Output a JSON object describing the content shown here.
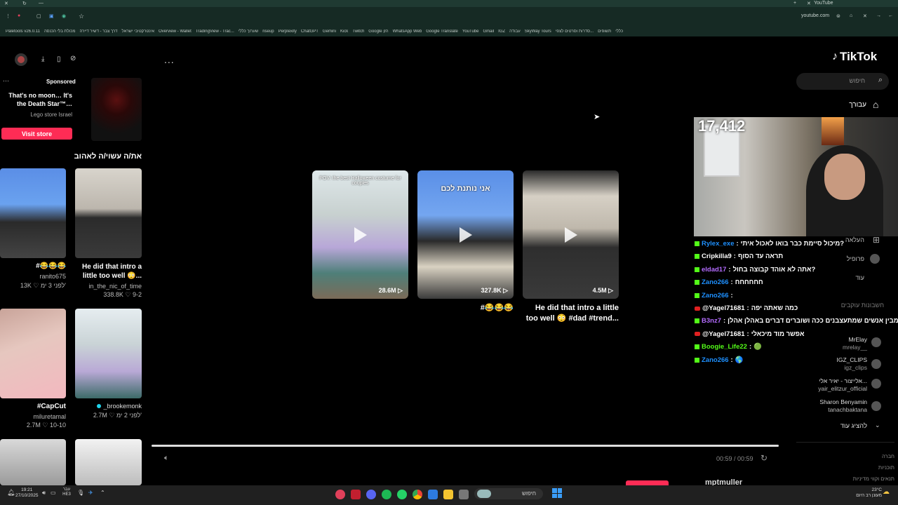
{
  "browser": {
    "tab_title": "YouTube",
    "url": "youtube.com",
    "bookmarks": [
      "Paletools v26.0.11",
      "מכולת בלי הכנסה",
      "דרך צבר - דשיר דיירה",
      "אינטרקטיבי ישראל",
      "Overview - Wallet",
      "TradingView - Trac...",
      "שערוך כללי",
      "riseup",
      "Perplexity",
      "ChatGPT",
      "Gemini",
      "Kick",
      "Twitch",
      "Google הזן",
      "WhatsApp Web",
      "Google Translate",
      "YouTube",
      "Gmail",
      "IGZ",
      "עבודה",
      "SkyWay Tours",
      "סדרות וסרטים לצפי...",
      "תשופים",
      "כללי"
    ]
  },
  "tiktok": {
    "logo": "TikTok",
    "search_placeholder": "חיפוש",
    "nav": {
      "home": "עבורך",
      "upload": "העלאה",
      "profile": "פרופיל",
      "more": "עוד"
    },
    "following_title": "חשבונות עוקבים",
    "following": [
      {
        "name": "MrElay",
        "handle": "mrelay__"
      },
      {
        "name": "IGZ_CLIPS",
        "handle": "igz_clips"
      },
      {
        "name": "אלייצור - יאיר אלי...",
        "handle": "yair_elitzur_official"
      },
      {
        "name": "Sharon Benyamin",
        "handle": "tanachbaktana"
      }
    ],
    "show_more": "להציג עוד",
    "footer": [
      "חברה",
      "תוכניות",
      "תנאים וקווי מדיניות"
    ],
    "ad": {
      "label": "Sponsored",
      "text": "That's no moon… It's the Death Star™…",
      "brand": "Lego store Israel",
      "cta": "Visit store"
    },
    "liked_title": "את/ה עשוי/ה לאהוב",
    "liked": [
      {
        "title": "#😂😂😂",
        "user": "ranito675",
        "stats": "13K ♡  לפני 3 ימ'"
      },
      {
        "title": "He did that intro a little too well 😳...",
        "user": "in_the_nic_of_time",
        "stats": "338.8K ♡  9-2"
      },
      {
        "title": "#CapCut",
        "user": "miluretamal",
        "stats": "2.7M ♡  10-10"
      },
      {
        "title": "_brookemonk",
        "user": "",
        "stats": "2.7M ♡  לפני 2 ימ'"
      }
    ],
    "more_menu": "...",
    "videos": [
      {
        "views": "28.6M",
        "caption": "POV: the best Halloween costume for couples",
        "title": ""
      },
      {
        "views": "327.8K",
        "caption": "אני נותנת לכם",
        "title": "#😂😂😂"
      },
      {
        "views": "4.5M",
        "caption": "",
        "title": "He did that intro a little too well 😳 #dad #trend..."
      }
    ],
    "player_time": "00:59 / 00:59",
    "bottom_user": "mptmuller"
  },
  "stream": {
    "viewer_count": "17,412",
    "chat": [
      {
        "user": "Rylex_exe",
        "msg": "מיכול סיימת כבר בואו לאכול איתי?",
        "color": "#1e90ff",
        "platform": "kick"
      },
      {
        "user": "Cripkilla9",
        "msg": "תראה עד הסוף",
        "color": "#ffffff",
        "platform": "kick"
      },
      {
        "user": "eldad17",
        "msg": "אתה לא אוהד קבוצה בחול?",
        "color": "#b36bff",
        "platform": "kick"
      },
      {
        "user": "Zano266",
        "msg": "חחחחחח",
        "color": "#1e90ff",
        "platform": "kick"
      },
      {
        "user": "Zano266",
        "msg": "",
        "color": "#1e90ff",
        "platform": "kick"
      },
      {
        "user": "@Yagel71681",
        "msg": "כמה שאתה יפה",
        "color": "#ffffff",
        "platform": "yt"
      },
      {
        "user": "B3nz7",
        "msg": "מבין אנשים שמתעצבנים ככה ושוברים דברים באהלן אהלן",
        "color": "#b36bff",
        "platform": "kick"
      },
      {
        "user": "@Yagel71681",
        "msg": "אפשר מוד מיכאלי",
        "color": "#ffffff",
        "platform": "yt"
      },
      {
        "user": "Boogie_Life22",
        "msg": "🟢",
        "color": "#53fc18",
        "platform": "kick"
      },
      {
        "user": "Zano266",
        "msg": "🌎",
        "color": "#1e90ff",
        "platform": "kick"
      }
    ]
  },
  "taskbar": {
    "search": "חיפוש",
    "time": "19:21",
    "date": "27/10/2025",
    "lang": "עבר HE3",
    "weather_temp": "23°C",
    "weather_text": "מעונן רב היום"
  }
}
